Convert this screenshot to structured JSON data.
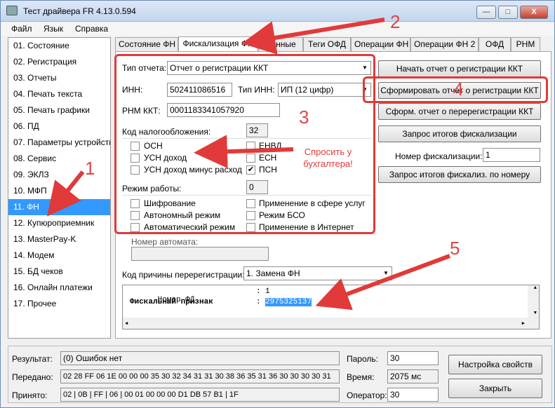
{
  "window": {
    "title": "Тест драйвера FR 4.13.0.594",
    "controls": [
      "—",
      "□",
      "X"
    ]
  },
  "menu": [
    "Файл",
    "Язык",
    "Справка"
  ],
  "left_list": {
    "items": [
      "01. Состояние",
      "02. Регистрация",
      "03. Отчеты",
      "04. Печать текста",
      "05. Печать графики",
      "06. ПД",
      "07. Параметры устройства",
      "08. Сервис",
      "09. ЭКЛЗ",
      "10. МФП",
      "11. ФН",
      "12. Купюроприемник",
      "13. MasterPay-K",
      "14. Модем",
      "15. БД чеков",
      "16. Онлайн платежи",
      "17. Прочее"
    ],
    "selected": "11. ФН"
  },
  "tabs": [
    "Состояние ФН",
    "Фискализация ФН",
    "Данные",
    "Теги ОФД",
    "Операции ФН",
    "Операции ФН 2",
    "ОФД",
    "РНМ"
  ],
  "active_tab": "Фискализация ФН",
  "form": {
    "report_type_label": "Тип отчета:",
    "report_type_value": "Отчет о регистрации ККТ",
    "inn_label": "ИНН:",
    "inn_value": "502411086516",
    "inn_type_label": "Тип ИНН:",
    "inn_type_value": "ИП (12 цифр)",
    "rnm_label": "РНМ ККТ:",
    "rnm_value": "0001183341057920",
    "tax_label": "Код налогообложения:",
    "tax_value": "32",
    "tax_options": [
      {
        "label": "ОСН",
        "checked": false
      },
      {
        "label": "УСН доход",
        "checked": false
      },
      {
        "label": "УСН доход минус расход",
        "checked": false
      },
      {
        "label": "ЕНВД",
        "checked": false
      },
      {
        "label": "ЕСН",
        "checked": false
      },
      {
        "label": "ПСН",
        "checked": true
      }
    ],
    "mode_label": "Режим работы:",
    "mode_value": "0",
    "mode_options": [
      {
        "label": "Шифрование",
        "checked": false
      },
      {
        "label": "Автономный режим",
        "checked": false
      },
      {
        "label": "Автоматический режим",
        "checked": false
      },
      {
        "label": "Применение в сфере услуг",
        "checked": false
      },
      {
        "label": "Режим БСО",
        "checked": false
      },
      {
        "label": "Применение в Интернет",
        "checked": false
      }
    ],
    "automat_label": "Номер автомата:",
    "automat_value": "",
    "rereg_label": "Код причины перерегистрации:",
    "rereg_value": "1. Замена ФН"
  },
  "buttons": {
    "start_report": "Начать отчет о регистрации ККТ",
    "form_report": "Сформировать отчет о регистрации ККТ",
    "rereg_report": "Сформ. отчет о перерегистрации ККТ",
    "query_totals": "Запрос итогов фискализации",
    "fisc_number_label": "Номер фискализации:",
    "fisc_number_value": "1",
    "query_totals_by_number": "Запрос итогов фискализ. по номеру"
  },
  "output": {
    "line1_key": "Номер ФД",
    "line1_val": "1",
    "line2_key": "Фискальный признак",
    "line2_val": "2975325137",
    "sep": ":"
  },
  "bottom": {
    "result_label": "Результат:",
    "result_value": "(0) Ошибок нет",
    "sent_label": "Передано:",
    "sent_value": "02 28 FF 06 1E 00 00 00 35 30 32 34 31 31 30 38 36 35 31 36 30 30 30 30 31",
    "recv_label": "Принято:",
    "recv_value": "02 | 0B | FF | 06 | 00 01 00 00 00 D1 DB 57 B1 | 1F",
    "password_label": "Пароль:",
    "password_value": "30",
    "time_label": "Время:",
    "time_value": "2075 мс",
    "operator_label": "Оператор:",
    "operator_value": "30",
    "settings_button": "Настройка свойств",
    "close_button": "Закрыть"
  },
  "annotations": {
    "numbers": [
      "1",
      "2",
      "3",
      "4",
      "5"
    ],
    "callout": "Спросить у бухгалтера!",
    "color": "#e03a3a"
  }
}
